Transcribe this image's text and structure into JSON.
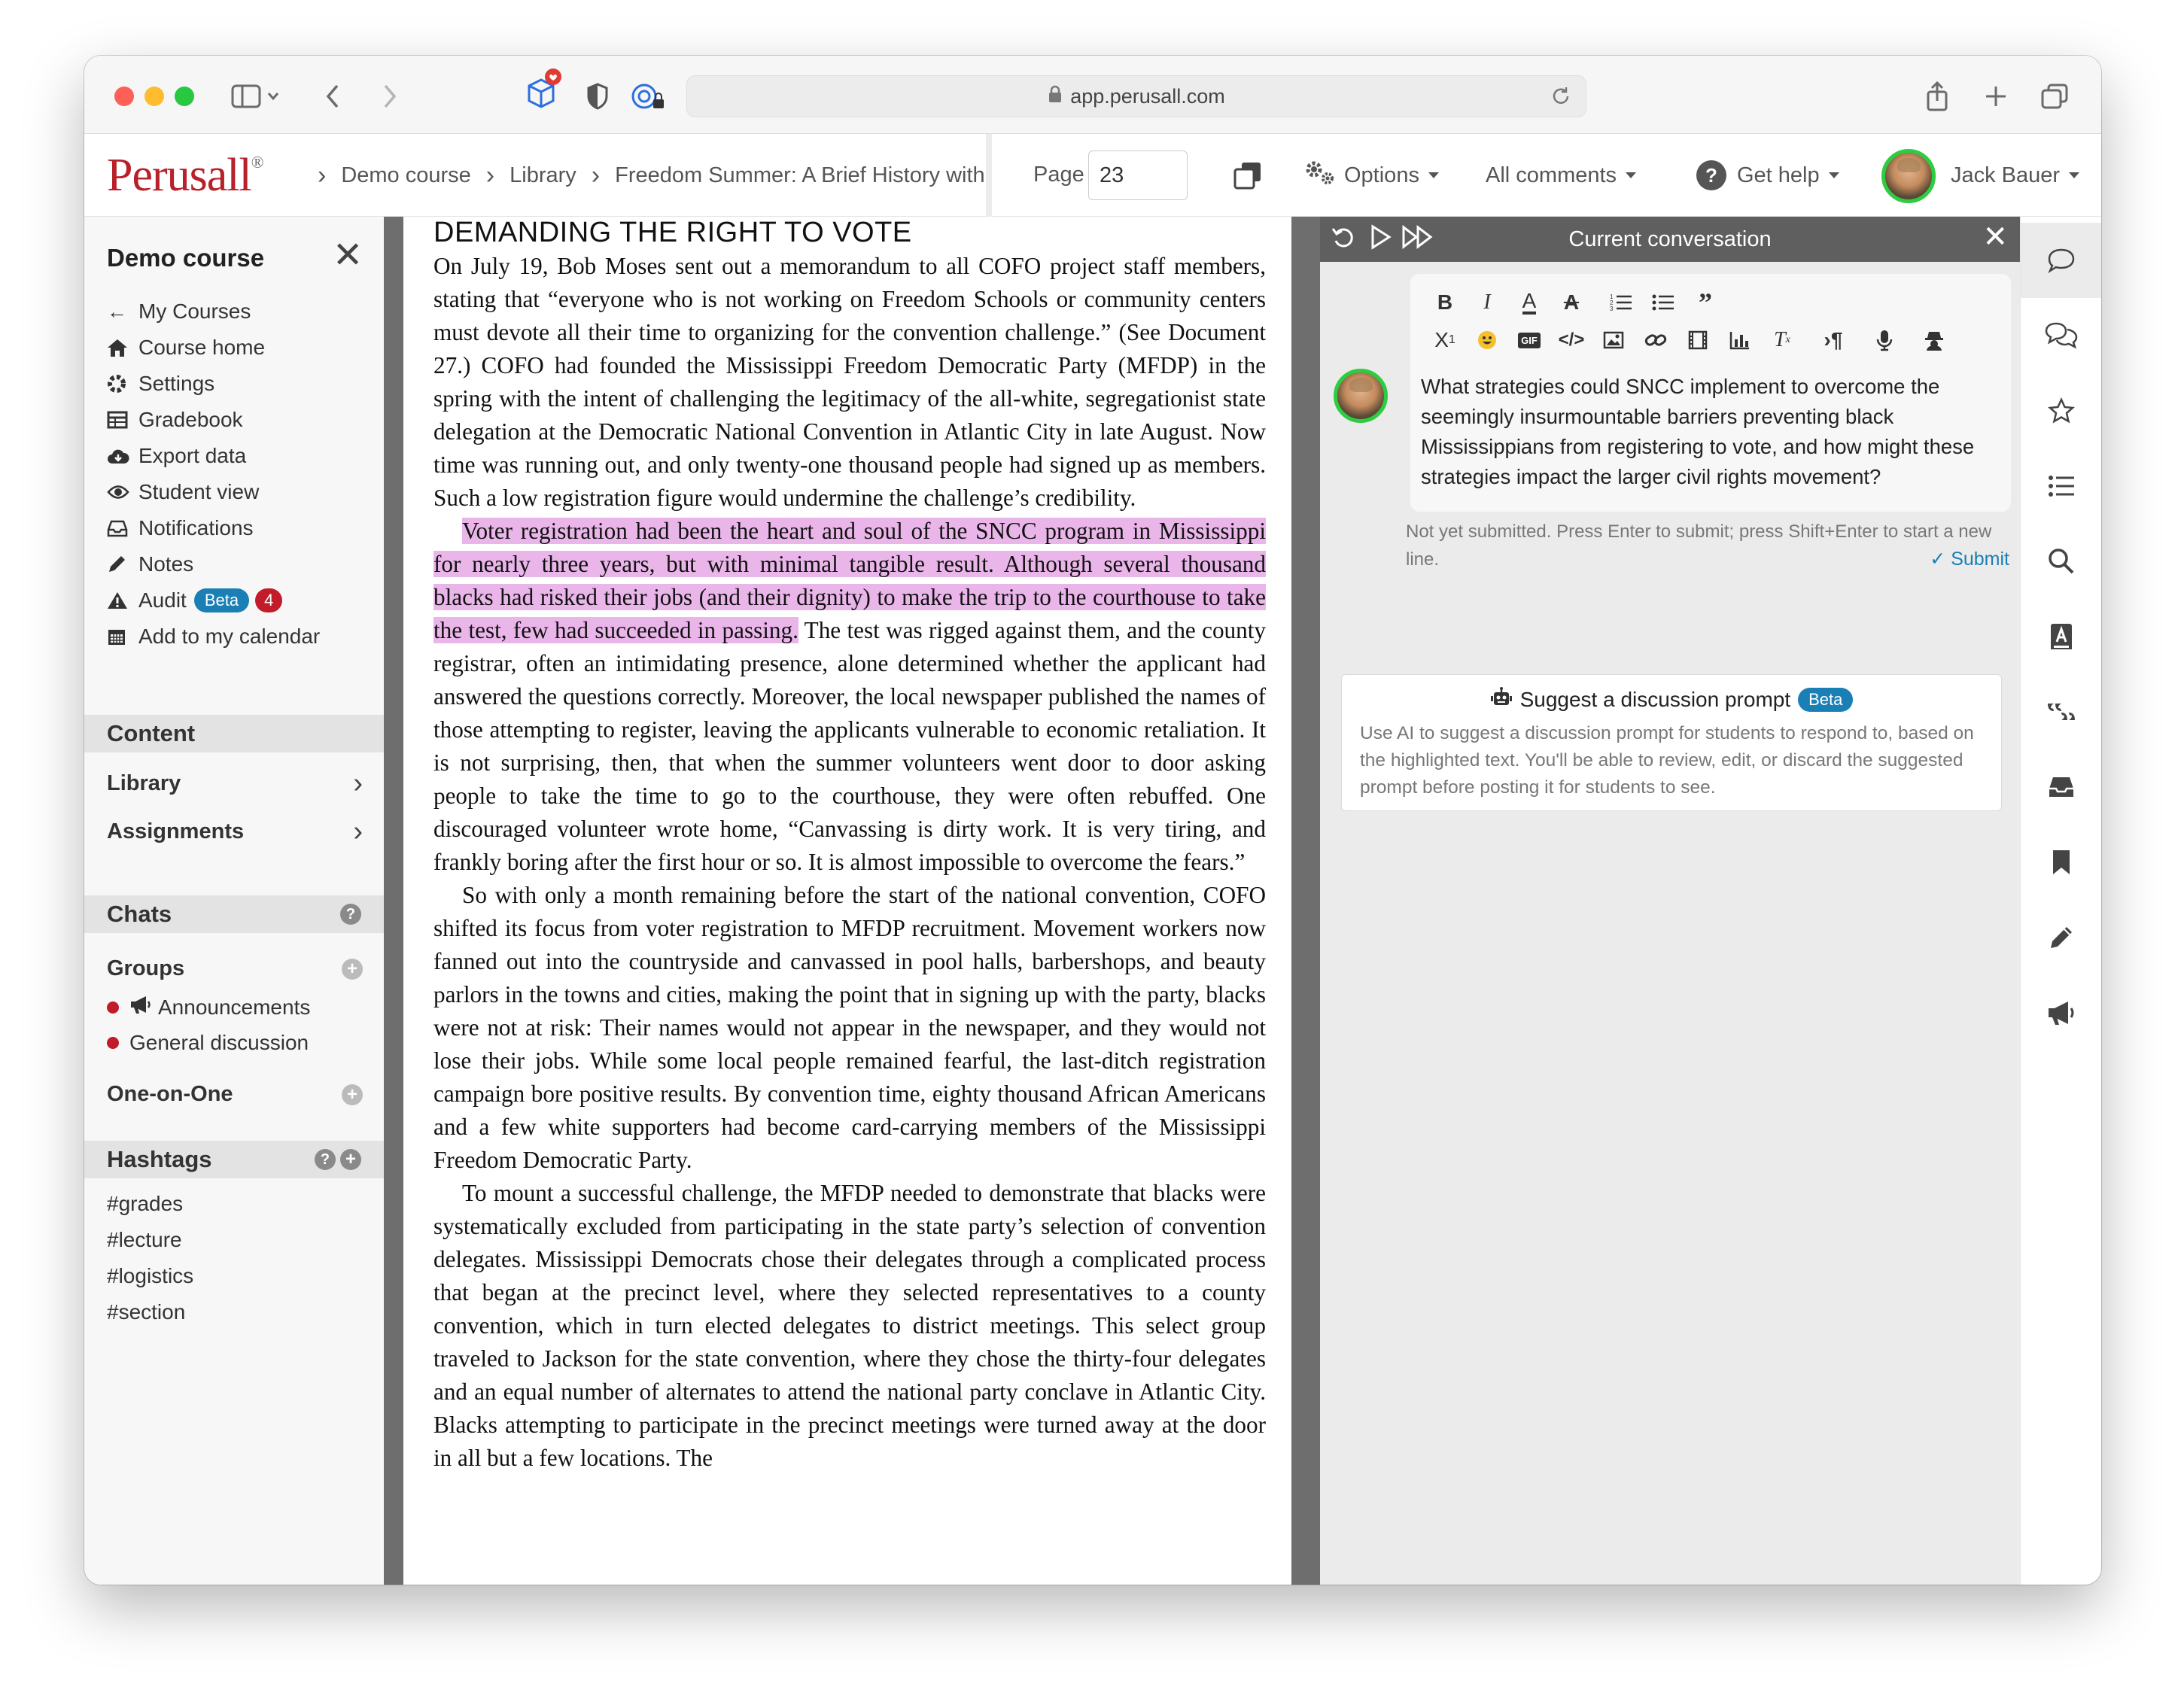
{
  "browser": {
    "url": "app.perusall.com"
  },
  "header": {
    "logo": "Perusall",
    "logo_mark": "®",
    "breadcrumbs": [
      "Demo course",
      "Library",
      "Freedom Summer: A Brief History with"
    ],
    "page_label": "Page",
    "page_value": "23",
    "options_label": "Options",
    "comments_label": "All comments",
    "help_label": "Get help",
    "user_name": "Jack Bauer"
  },
  "sidebar": {
    "title": "Demo course",
    "links": [
      {
        "icon": "arrow-left-icon",
        "label": "My Courses"
      },
      {
        "icon": "home-icon",
        "label": "Course home"
      },
      {
        "icon": "gear-icon",
        "label": "Settings"
      },
      {
        "icon": "gradebook-icon",
        "label": "Gradebook"
      },
      {
        "icon": "cloud-download-icon",
        "label": "Export data"
      },
      {
        "icon": "eye-icon",
        "label": "Student view"
      },
      {
        "icon": "inbox-icon",
        "label": "Notifications"
      },
      {
        "icon": "pencil-icon",
        "label": "Notes"
      },
      {
        "icon": "warning-icon",
        "label": "Audit",
        "badge": "Beta",
        "count": "4"
      },
      {
        "icon": "calendar-icon",
        "label": "Add to my calendar"
      }
    ],
    "content_header": "Content",
    "content_items": [
      "Library",
      "Assignments"
    ],
    "chats_header": "Chats",
    "groups_label": "Groups",
    "group_chats": [
      {
        "label": "Announcements",
        "icon": "megaphone-icon"
      },
      {
        "label": "General discussion",
        "icon": ""
      }
    ],
    "one_on_one_label": "One-on-One",
    "hashtags_header": "Hashtags",
    "hashtags": [
      "#grades",
      "#lecture",
      "#logistics",
      "#section"
    ]
  },
  "document": {
    "heading": "DEMANDING THE RIGHT TO VOTE",
    "p1": "On July 19, Bob Moses sent out a memorandum to all COFO project staff members, stating that “everyone who is not working on Freedom Schools or community centers must devote all their time to organizing for the convention challenge.” (See Document 27.) COFO had founded the Mississippi Freedom Democratic Party (MFDP) in the spring with the intent of challenging the legitimacy of the all-white, segregationist state delegation at the Democratic National Convention in Atlantic City in late August. Now time was running out, and only twenty-one thousand people had signed up as members. Such a low registration figure would undermine the challenge’s credibility.",
    "p2_highlight": "Voter registration had been the heart and soul of the SNCC program in Mississippi for nearly three years, but with minimal tangible result. Although several thousand blacks had risked their jobs (and their dignity) to make the trip to the courthouse to take the test, few had succeeded in passing.",
    "p2_rest": " The test was rigged against them, and the county registrar, often an intimidating presence, alone determined whether the applicant had answered the questions correctly. Moreover, the local newspaper published the names of those attempting to register, leaving the applicants vulnerable to economic retaliation. It is not surprising, then, that when the summer volunteers went door to door asking people to take the time to go to the courthouse, they were often rebuffed. One discouraged volunteer wrote home, “Canvassing is dirty work. It is very tiring, and frankly boring after the first hour or so. It is almost impossible to overcome the fears.”",
    "p3": "So with only a month remaining before the start of the national convention, COFO shifted its focus from voter registration to MFDP recruitment. Movement workers now fanned out into the countryside and canvassed in pool halls, barbershops, and beauty parlors in the towns and cities, making the point that in signing up with the party, blacks were not at risk: Their names would not appear in the newspaper, and they would not lose their jobs. While some local people remained fearful, the last-ditch registration campaign bore positive results. By convention time, eighty thousand African Americans and a few white supporters had become card-carrying members of the Mississippi Freedom Democratic Party.",
    "p4": "To mount a successful challenge, the MFDP needed to demonstrate that blacks were systematically excluded from participating in the state party’s selection of convention delegates. Mississippi Democrats chose their delegates through a complicated process that began at the precinct level, where they selected representatives to a county convention, which in turn elected delegates to district meetings. This select group traveled to Jackson for the state convention, where they chose the thirty-four delegates and an equal number of alternates to attend the national party conclave in Atlantic City. Blacks attempting to participate in the precinct meetings were turned away at the door in all but a few locations. The",
    "highlight_color": "#eab6ea"
  },
  "conversation": {
    "title": "Current conversation",
    "draft_text": "What strategies could SNCC implement to overcome the seemingly insurmountable barriers preventing black Mississippians from registering to vote, and how might these strategies impact the larger civil rights movement?",
    "hint": "Not yet submitted. Press Enter to submit; press Shift+Enter to start a new line.",
    "submit_label": "Submit",
    "suggest_title": "Suggest a discussion prompt",
    "suggest_badge": "Beta",
    "suggest_desc": "Use AI to suggest a discussion prompt for students to respond to, based on the highlighted text. You'll be able to review, edit, or discard the suggested prompt before posting it for students to see."
  },
  "colors": {
    "brand": "#b8202a",
    "accent": "#1a7fb5",
    "badge_red": "#c21b2a",
    "avatar_ring": "#2ecc40"
  }
}
